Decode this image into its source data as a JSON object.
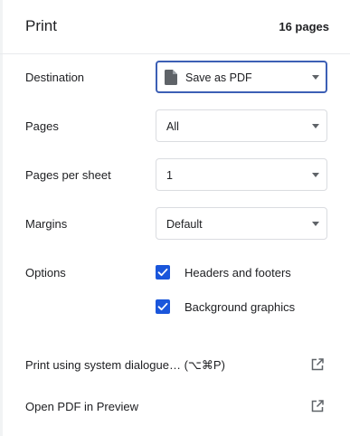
{
  "header": {
    "title": "Print",
    "page_count": "16 pages"
  },
  "settings": {
    "destination": {
      "label": "Destination",
      "value": "Save as PDF",
      "icon": "document-icon"
    },
    "pages": {
      "label": "Pages",
      "value": "All"
    },
    "pages_per_sheet": {
      "label": "Pages per sheet",
      "value": "1"
    },
    "margins": {
      "label": "Margins",
      "value": "Default"
    },
    "options": {
      "label": "Options",
      "items": [
        {
          "label": "Headers and footers",
          "checked": true
        },
        {
          "label": "Background graphics",
          "checked": true
        }
      ]
    }
  },
  "links": {
    "system_dialogue": {
      "label": "Print using system dialogue… (⌥⌘P)",
      "icon": "open-external-icon"
    },
    "open_preview": {
      "label": "Open PDF in Preview",
      "icon": "open-external-icon"
    }
  },
  "colors": {
    "accent": "#1a56db",
    "focus_border": "#3c5fb5",
    "text": "#202124",
    "border": "#dadce0"
  }
}
